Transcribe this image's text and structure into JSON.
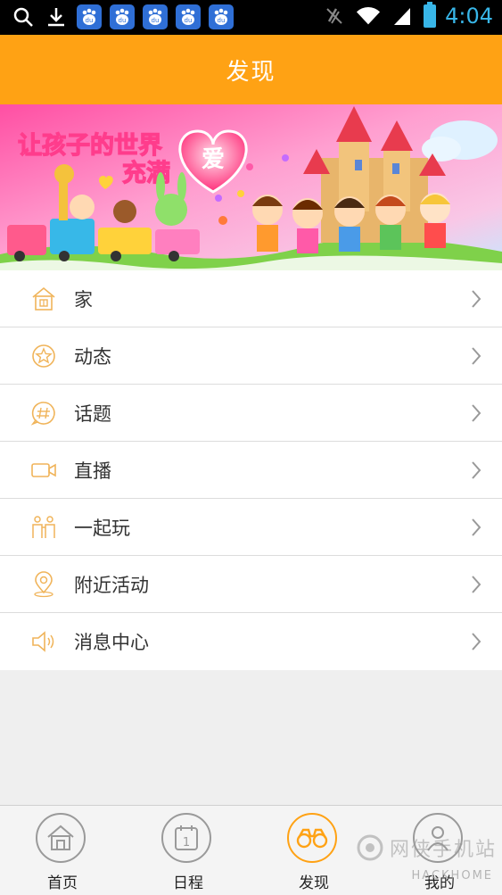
{
  "status_bar": {
    "time": "4:04",
    "icons": [
      "search-icon",
      "download-icon",
      "baidu-icon",
      "baidu-icon",
      "baidu-icon",
      "baidu-icon",
      "baidu-icon",
      "vibrate-icon",
      "wifi-icon",
      "signal-icon",
      "battery-icon"
    ],
    "baidu_label": "du"
  },
  "header": {
    "title": "发现"
  },
  "banner": {
    "slogan_line1": "让孩子的世界",
    "slogan_line2": "充满",
    "heart_text": "爱"
  },
  "menu": {
    "items": [
      {
        "label": "家",
        "icon": "home-icon"
      },
      {
        "label": "动态",
        "icon": "star-circle-icon"
      },
      {
        "label": "话题",
        "icon": "hashtag-bubble-icon"
      },
      {
        "label": "直播",
        "icon": "video-camera-icon"
      },
      {
        "label": "一起玩",
        "icon": "people-icon"
      },
      {
        "label": "附近活动",
        "icon": "location-pin-icon"
      },
      {
        "label": "消息中心",
        "icon": "speaker-icon"
      }
    ]
  },
  "tabbar": {
    "tabs": [
      {
        "label": "首页",
        "icon": "home-icon",
        "active": false
      },
      {
        "label": "日程",
        "icon": "calendar-icon",
        "active": false,
        "calendar_day": "1"
      },
      {
        "label": "发现",
        "icon": "binoculars-icon",
        "active": true
      },
      {
        "label": "我的",
        "icon": "person-icon",
        "active": false
      }
    ]
  },
  "watermark": {
    "text": "网侠手机站",
    "sub": "HACKHOME"
  },
  "colors": {
    "accent": "#ffa214",
    "status_time": "#38b6e8"
  }
}
